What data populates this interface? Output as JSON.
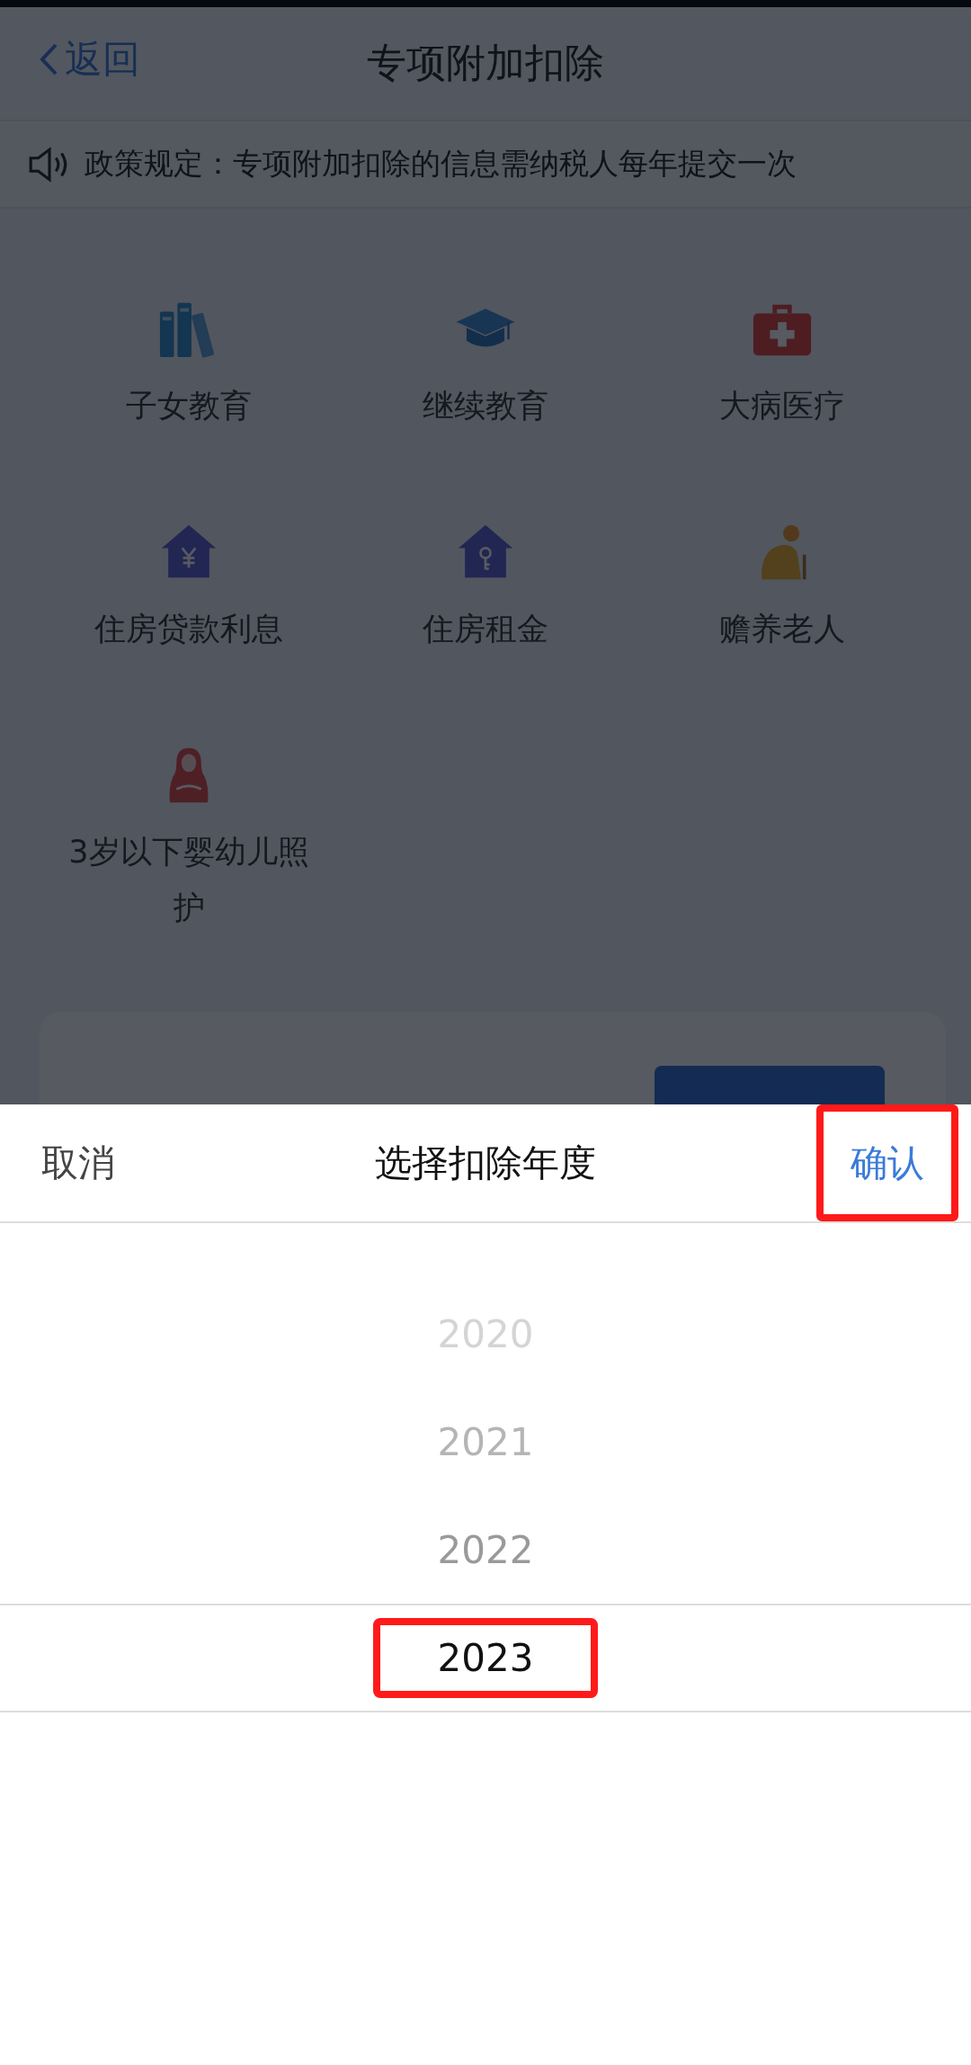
{
  "nav": {
    "back": "返回",
    "title": "专项附加扣除"
  },
  "notice": "政策规定：专项附加扣除的信息需纳税人每年提交一次",
  "items": [
    {
      "label": "子女教育",
      "kind": "books"
    },
    {
      "label": "继续教育",
      "kind": "cap"
    },
    {
      "label": "大病医疗",
      "kind": "medkit"
    },
    {
      "label": "住房贷款利息",
      "kind": "house-yen"
    },
    {
      "label": "住房租金",
      "kind": "house-key"
    },
    {
      "label": "赡养老人",
      "kind": "elder"
    },
    {
      "label": "3岁以下婴幼儿照护",
      "kind": "mother"
    }
  ],
  "sheet": {
    "cancel": "取消",
    "title": "选择扣除年度",
    "confirm": "确认",
    "confirm_highlighted": true,
    "years": [
      {
        "label": "2020",
        "selected": false,
        "highlighted": false
      },
      {
        "label": "2021",
        "selected": false,
        "highlighted": false
      },
      {
        "label": "2022",
        "selected": false,
        "highlighted": false
      },
      {
        "label": "2023",
        "selected": true,
        "highlighted": true
      }
    ]
  }
}
